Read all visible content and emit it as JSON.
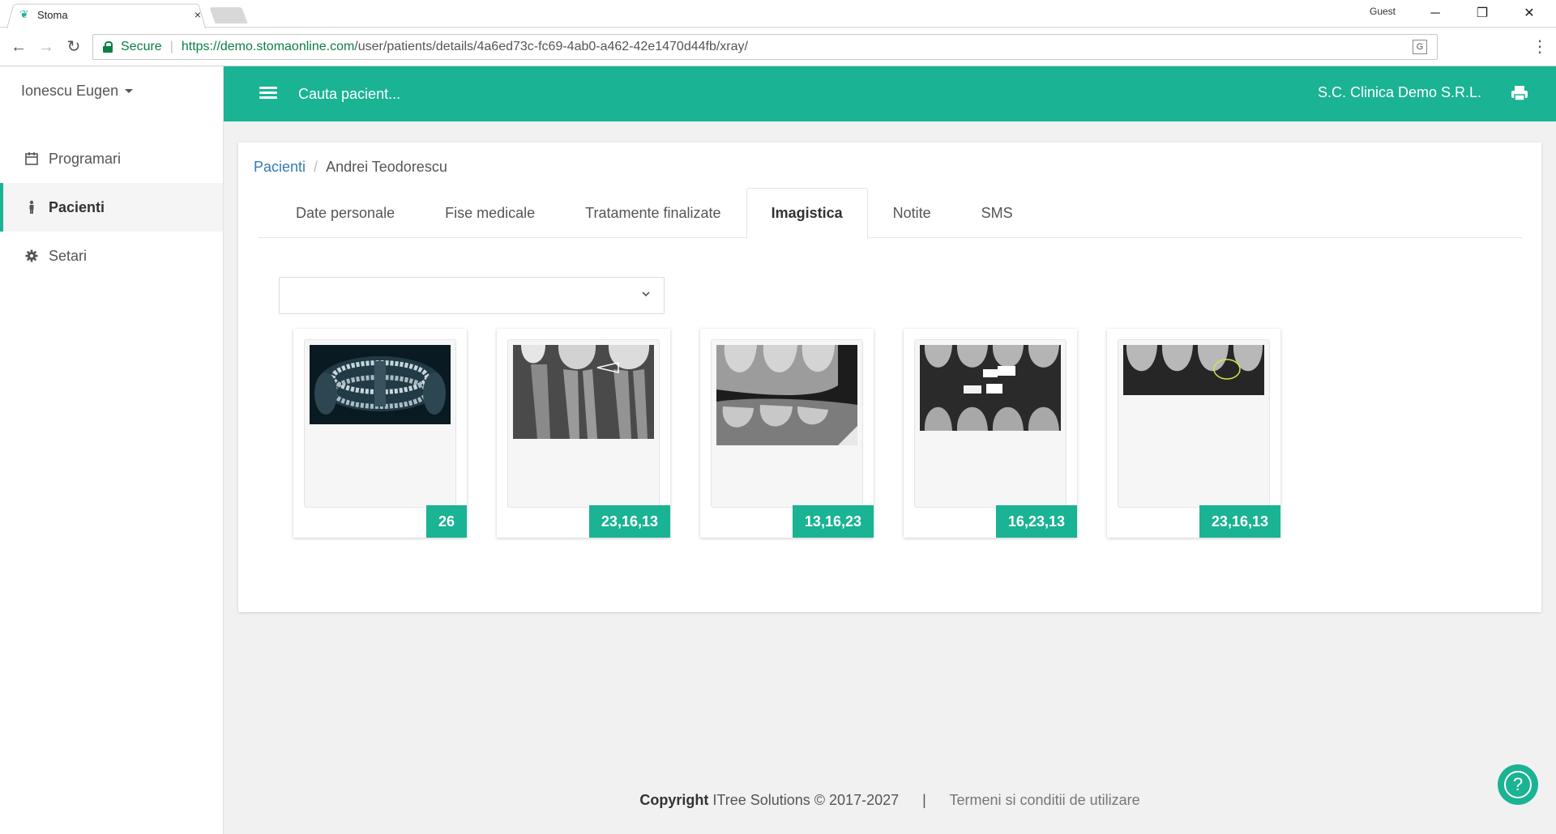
{
  "browser": {
    "tab_title": "Stoma",
    "tab_close": "×",
    "guest_label": "Guest",
    "secure_label": "Secure",
    "url_host": "https://demo.stomaonline.com",
    "url_path": "/user/patients/details/4a6ed73c-fc69-4ab0-a462-42e1470d44fb/xray/"
  },
  "sidebar": {
    "user_name": "Ionescu Eugen",
    "items": [
      {
        "label": "Programari",
        "icon": "calendar-icon"
      },
      {
        "label": "Pacienti",
        "icon": "person-icon",
        "active": true
      },
      {
        "label": "Setari",
        "icon": "gear-icon"
      }
    ]
  },
  "topbar": {
    "search_placeholder": "Cauta pacient...",
    "clinic_name": "S.C. Clinica Demo S.R.L."
  },
  "breadcrumb": {
    "root": "Pacienti",
    "separator": "/",
    "current": "Andrei Teodorescu"
  },
  "tabs": [
    {
      "label": "Date personale"
    },
    {
      "label": "Fise medicale"
    },
    {
      "label": "Tratamente finalizate"
    },
    {
      "label": "Imagistica",
      "active": true
    },
    {
      "label": "Notite"
    },
    {
      "label": "SMS"
    }
  ],
  "select": {
    "value": ""
  },
  "xrays": [
    {
      "teeth": "26"
    },
    {
      "teeth": "23,16,13"
    },
    {
      "teeth": "13,16,23"
    },
    {
      "teeth": "16,23,13"
    },
    {
      "teeth": "23,16,13"
    }
  ],
  "footer": {
    "copyright_bold": "Copyright",
    "copyright_text": " ITree Solutions © 2017-2027",
    "separator": "|",
    "terms_link": "Termeni si conditii de utilizare"
  },
  "help": {
    "label": "?"
  },
  "colors": {
    "accent": "#1ab394",
    "link": "#337ab7"
  }
}
